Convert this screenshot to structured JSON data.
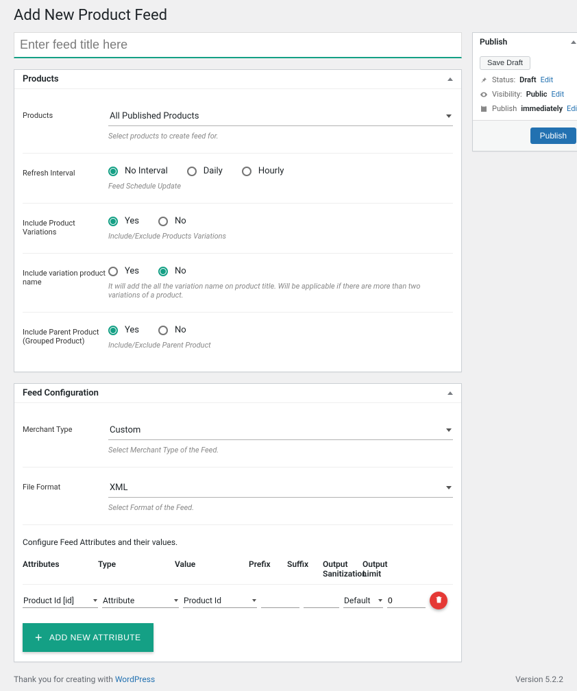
{
  "page": {
    "title": "Add New Product Feed",
    "title_placeholder": "Enter feed title here"
  },
  "products_box": {
    "title": "Products",
    "products": {
      "label": "Products",
      "value": "All Published Products",
      "helper": "Select products to create feed for."
    },
    "refresh": {
      "label": "Refresh Interval",
      "options": [
        "No Interval",
        "Daily",
        "Hourly"
      ],
      "selected": "No Interval",
      "helper": "Feed Schedule Update"
    },
    "variations": {
      "label": "Include Product Variations",
      "options": [
        "Yes",
        "No"
      ],
      "selected": "Yes",
      "helper": "Include/Exclude Products Variations"
    },
    "variation_name": {
      "label": "Include variation product name",
      "options": [
        "Yes",
        "No"
      ],
      "selected": "No",
      "helper": "It will add the all the variation name on product title. Will be applicable if there are more than two variations of a product."
    },
    "parent": {
      "label": "Include Parent Product (Grouped Product)",
      "options": [
        "Yes",
        "No"
      ],
      "selected": "Yes",
      "helper": "Include/Exclude Parent Product"
    }
  },
  "feed_config": {
    "title": "Feed Configuration",
    "merchant": {
      "label": "Merchant Type",
      "value": "Custom",
      "helper": "Select Merchant Type of the Feed."
    },
    "format": {
      "label": "File Format",
      "value": "XML",
      "helper": "Select Format of the Feed."
    },
    "configure_text": "Configure Feed Attributes and their values.",
    "columns": {
      "attributes": "Attributes",
      "type": "Type",
      "value": "Value",
      "prefix": "Prefix",
      "suffix": "Suffix",
      "sanitization": "Output Sanitization",
      "limit": "Output Limit"
    },
    "row": {
      "attribute": "Product Id [id]",
      "type": "Attribute",
      "value": "Product Id",
      "prefix": "",
      "suffix": "",
      "sanitization": "Default",
      "limit": "0"
    },
    "add_button": "Add New Attribute"
  },
  "publish": {
    "title": "Publish",
    "save_draft": "Save Draft",
    "status_label": "Status:",
    "status_value": "Draft",
    "visibility_label": "Visibility:",
    "visibility_value": "Public",
    "schedule_label": "Publish",
    "schedule_value": "immediately",
    "edit": "Edit",
    "publish_btn": "Publish"
  },
  "footer": {
    "thank_you_1": "Thank you for creating with ",
    "thank_you_link": "WordPress",
    "version": "Version 5.2.2"
  }
}
